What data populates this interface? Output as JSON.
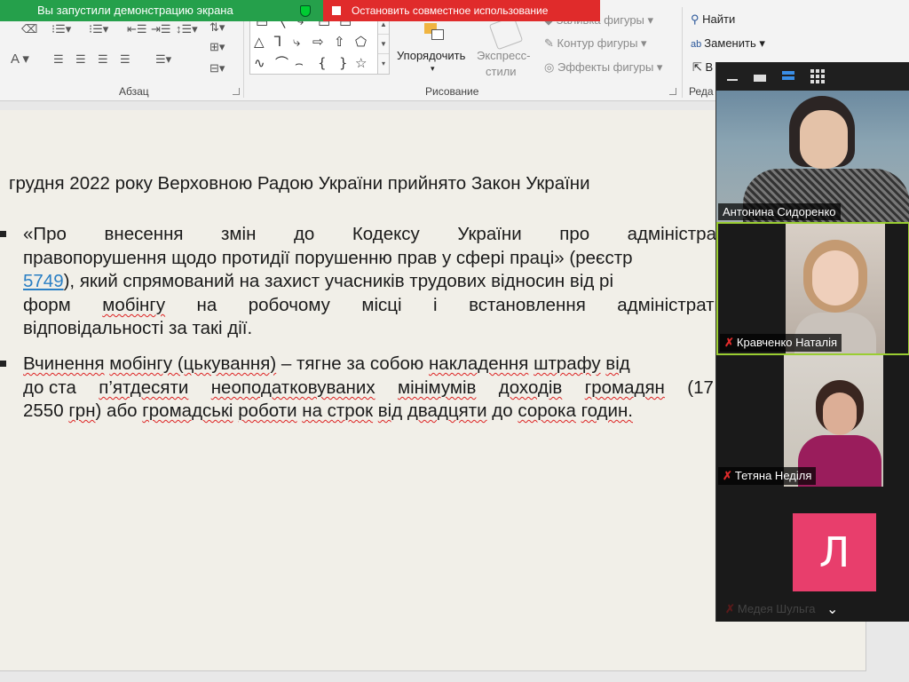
{
  "share_bar": {
    "status_text": "Вы запустили демонстрацию экрана",
    "stop_text": "Остановить совместное использование"
  },
  "ribbon": {
    "paragraph_group": "Абзац",
    "drawing_group": "Рисование",
    "editing_group_partial": "Реда",
    "arrange_label": "Упорядочить",
    "quick_styles_label_1": "Экспресс-",
    "quick_styles_label_2": "стили",
    "shape_fill": "Заливка фигуры",
    "shape_outline": "Контур фигуры",
    "shape_effects": "Эффекты фигуры",
    "find": "Найти",
    "replace": "Заменить",
    "select_partial": "В"
  },
  "slide": {
    "line1": "грудня 2022 року Верховною Радою України прийнято Закон України",
    "b1_l1_words": [
      "«Про",
      "внесення",
      "змін",
      "до",
      "Кодексу",
      "України",
      "про",
      "адміністрат"
    ],
    "b1_l2": "правопорушення щодо протидії порушенню прав у сфері праці» (реєстр",
    "b1_l3_link": "5749",
    "b1_l3_rest": "), який спрямований на захист учасників трудових відносин від рі",
    "b1_l4_a": "форм",
    "b1_l4_b": "мобінгу",
    "b1_l4_c": "на",
    "b1_l4_d": "робочому",
    "b1_l4_e": "місці",
    "b1_l4_f": "і",
    "b1_l4_g": "встановлення",
    "b1_l4_h": "адміністрати",
    "b1_l5": "відповідальності за такі дії.",
    "b2_l1_a": "Вчинення",
    "b2_l1_b": "мобінгу (цькування)",
    "b2_l1_c": "– тягне за собою",
    "b2_l1_d": "накладення",
    "b2_l1_e": "штрафу",
    "b2_l1_f": "від",
    "b2_l2_a": "до ста",
    "b2_l2_b": "п’ятдесяти",
    "b2_l2_c": "неоподатковуваних",
    "b2_l2_d": "мінімумів",
    "b2_l2_e": "доходів",
    "b2_l2_f": "громадян",
    "b2_l2_g": "(17",
    "b2_l3_a": "2550",
    "b2_l3_b": "грн",
    "b2_l3_c": ") або",
    "b2_l3_d": "громадські",
    "b2_l3_e": "роботи",
    "b2_l3_f": "на строк",
    "b2_l3_g": "від",
    "b2_l3_h": "двадцяти",
    "b2_l3_i": "до",
    "b2_l3_j": "сорока",
    "b2_l3_k": "годин."
  },
  "participants": [
    {
      "name": "Антонина Сидоренко",
      "muted": false
    },
    {
      "name": "Кравченко Наталія",
      "muted": true
    },
    {
      "name": "Тетяна Неділя",
      "muted": true
    },
    {
      "name": "Медея Шульга",
      "muted": true,
      "avatar_letter": "Л"
    }
  ],
  "colors": {
    "share_green": "#25a04b",
    "share_red": "#e02b2b",
    "avatar_pink": "#e83e6c",
    "active_speaker": "#9acd32"
  }
}
